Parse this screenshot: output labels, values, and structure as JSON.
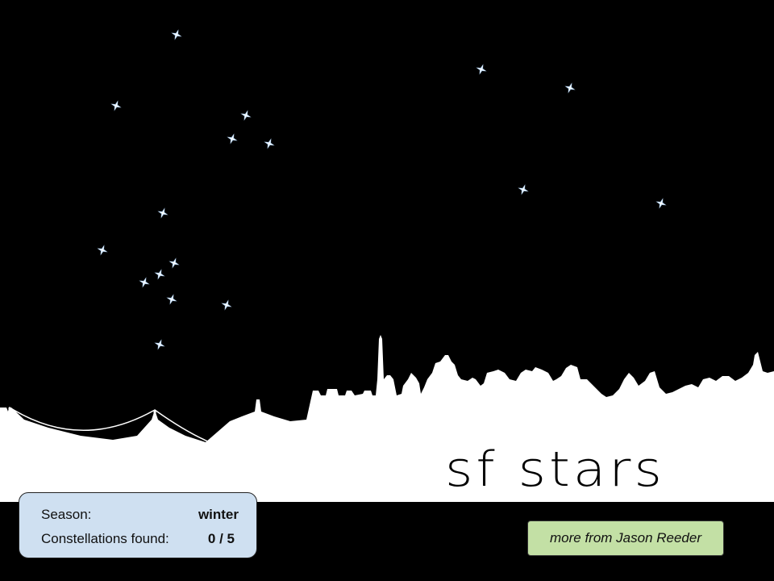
{
  "title": "SF stars",
  "status": {
    "season_label": "Season:",
    "season_value": "winter",
    "found_label": "Constellations found:",
    "found_value": "0 / 5",
    "found_count": 0,
    "found_total": 5
  },
  "more_button": {
    "label": "more from Jason Reeder"
  },
  "colors": {
    "sky": "#000000",
    "ground": "#ffffff",
    "star": "#ffffff",
    "star_glow": "#9fc3e6",
    "panel_bg": "#cfe0f1",
    "button_bg": "#c3e0a5"
  }
}
